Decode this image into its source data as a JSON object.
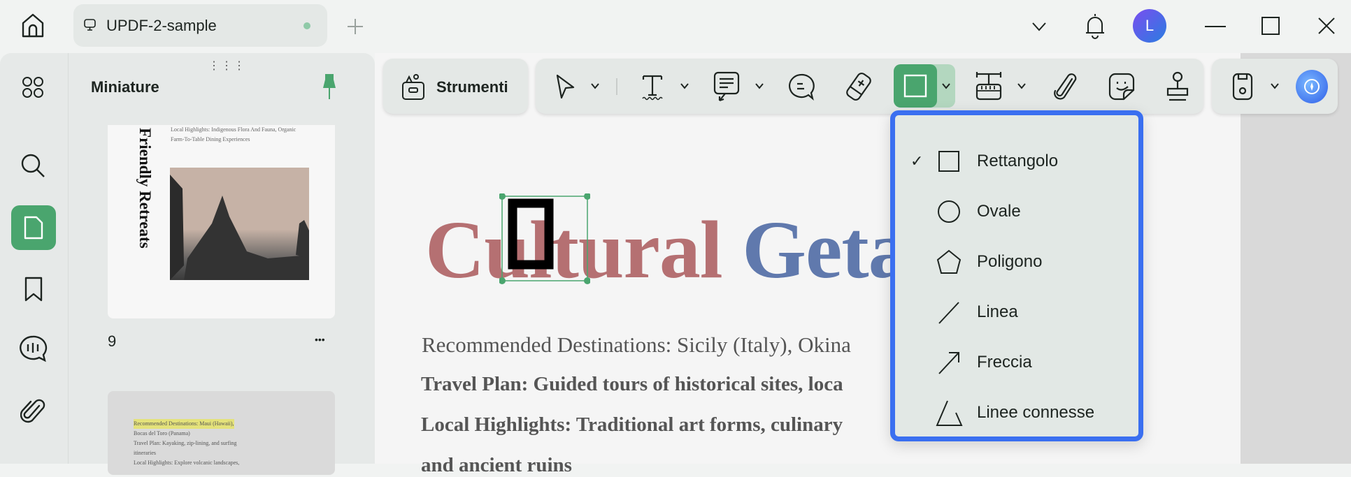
{
  "titlebar": {
    "tab_title": "UPDF-2-sample",
    "avatar_letter": "L"
  },
  "thumbnails": {
    "title": "Miniature",
    "page_number": "9",
    "more": "•••",
    "card1": {
      "vertical_title": "Friendly Retreats",
      "line1": "Local Highlights: Indigenous Flora And Fauna, Organic",
      "line2": "Farm-To-Table Dining Experiences"
    },
    "card2": {
      "lines": [
        "Recommended Destinations: Maui (Hawaii),",
        "Bocas del Toro (Panama)",
        "Travel Plan: Kayaking, zip-lining, and surfing",
        "itineraries",
        "Local Highlights: Explore volcanic landscapes,"
      ]
    }
  },
  "toolbar": {
    "tools_label": "Strumenti"
  },
  "document": {
    "title_part1": "Cultural",
    "title_part2": "Geta",
    "line1": "Recommended Destinations: Sicily (Italy), Okina",
    "line2": "Travel Plan: Guided tours of historical sites, loca",
    "line3": "Local Highlights: Traditional art forms, culinary",
    "line4": "and ancient ruins"
  },
  "shape_menu": {
    "items": [
      {
        "label": "Rettangolo",
        "selected": true
      },
      {
        "label": "Ovale"
      },
      {
        "label": "Poligono"
      },
      {
        "label": "Linea"
      },
      {
        "label": "Freccia"
      },
      {
        "label": "Linee connesse"
      }
    ]
  },
  "colors": {
    "accent": "#4aa56e",
    "menu_border": "#3a6ff0",
    "title_red": "#b57072",
    "title_blue": "#6079ad"
  }
}
